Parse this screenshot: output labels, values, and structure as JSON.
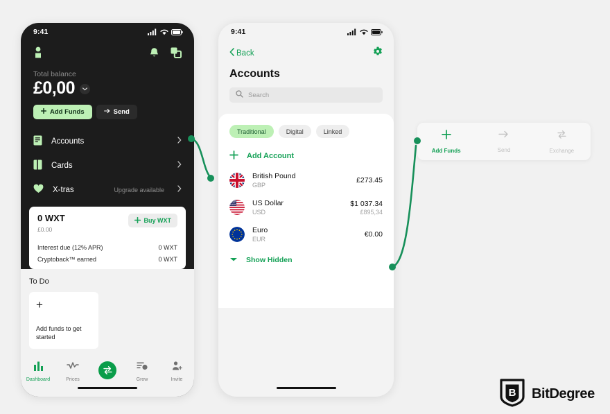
{
  "background": "#f1f1f1",
  "colors": {
    "accent_green": "#13a055",
    "light_green": "#bdf0b5",
    "dark_phone_bg": "#1c1c1c",
    "fab_green": "#0a9d4a"
  },
  "phone_left": {
    "status": {
      "time": "9:41",
      "signal_icon": "cellular-bars-icon",
      "wifi_icon": "wifi-icon",
      "battery_icon": "battery-icon"
    },
    "topbar": {
      "profile_icon": "profile-avatar-icon",
      "notifications_icon": "bell-icon",
      "scan_icon": "scan-qr-icon"
    },
    "balance": {
      "label": "Total balance",
      "amount": "£0,00",
      "chevron_icon": "chevron-down-icon"
    },
    "actions": [
      {
        "label": "Add Funds",
        "icon": "plus-icon",
        "style": "primary"
      },
      {
        "label": "Send",
        "icon": "arrow-right-icon",
        "style": "ghost"
      }
    ],
    "menu": [
      {
        "label": "Accounts",
        "icon": "accounts-icon",
        "note": "",
        "chevron": "›"
      },
      {
        "label": "Cards",
        "icon": "cards-icon",
        "note": "",
        "chevron": "›"
      },
      {
        "label": "X-tras",
        "icon": "heart-icon",
        "note": "Upgrade available",
        "chevron": "›"
      }
    ],
    "wxt_card": {
      "amount": "0 WXT",
      "fiat": "£0.00",
      "buy_label": "Buy WXT",
      "buy_icon": "plus-icon",
      "rows": [
        {
          "label": "Interest due (12% APR)",
          "value": "0 WXT"
        },
        {
          "label": "Cryptoback™ earned",
          "value": "0 WXT"
        }
      ]
    },
    "todo": {
      "title": "To Do",
      "card_plus_icon": "plus-icon",
      "card_text": "Add funds to get started"
    },
    "tabbar": [
      {
        "label": "Dashboard",
        "icon": "bar-chart-icon",
        "active": true
      },
      {
        "label": "Prices",
        "icon": "line-chart-icon",
        "active": false
      },
      {
        "label": "",
        "icon": "exchange-swap-icon",
        "active": false,
        "fab": true
      },
      {
        "label": "Grow",
        "icon": "grow-icon",
        "active": false
      },
      {
        "label": "Invite",
        "icon": "invite-person-icon",
        "active": false
      }
    ]
  },
  "phone_mid": {
    "status": {
      "time": "9:41",
      "signal_icon": "cellular-bars-icon",
      "wifi_icon": "wifi-icon",
      "battery_icon": "battery-icon"
    },
    "nav": {
      "back_label": "Back",
      "back_icon": "chevron-left-icon",
      "settings_icon": "gear-icon"
    },
    "title": "Accounts",
    "search": {
      "placeholder": "Search",
      "icon": "search-icon"
    },
    "chips": [
      {
        "label": "Traditional",
        "selected": true
      },
      {
        "label": "Digital",
        "selected": false
      },
      {
        "label": "Linked",
        "selected": false
      }
    ],
    "add_account": {
      "label": "Add Account",
      "icon": "plus-icon"
    },
    "accounts": [
      {
        "name": "British Pound",
        "code": "GBP",
        "primary": "£273.45",
        "secondary": "",
        "flag": "uk-flag-icon"
      },
      {
        "name": "US Dollar",
        "code": "USD",
        "primary": "$1 037.34",
        "secondary": "£895,34",
        "flag": "us-flag-icon"
      },
      {
        "name": "Euro",
        "code": "EUR",
        "primary": "€0.00",
        "secondary": "",
        "flag": "eu-flag-icon"
      }
    ],
    "show_hidden": {
      "label": "Show Hidden",
      "icon": "chevron-down-icon"
    }
  },
  "action_card": {
    "items": [
      {
        "label": "Add Funds",
        "icon": "plus-icon",
        "enabled": true
      },
      {
        "label": "Send",
        "icon": "arrow-right-icon",
        "enabled": false
      },
      {
        "label": "Exchange",
        "icon": "exchange-swap-icon",
        "enabled": false
      }
    ]
  },
  "logo": {
    "wordmark": "BitDegree",
    "mark_letter": "B",
    "shield_icon": "bitdegree-shield-icon"
  }
}
